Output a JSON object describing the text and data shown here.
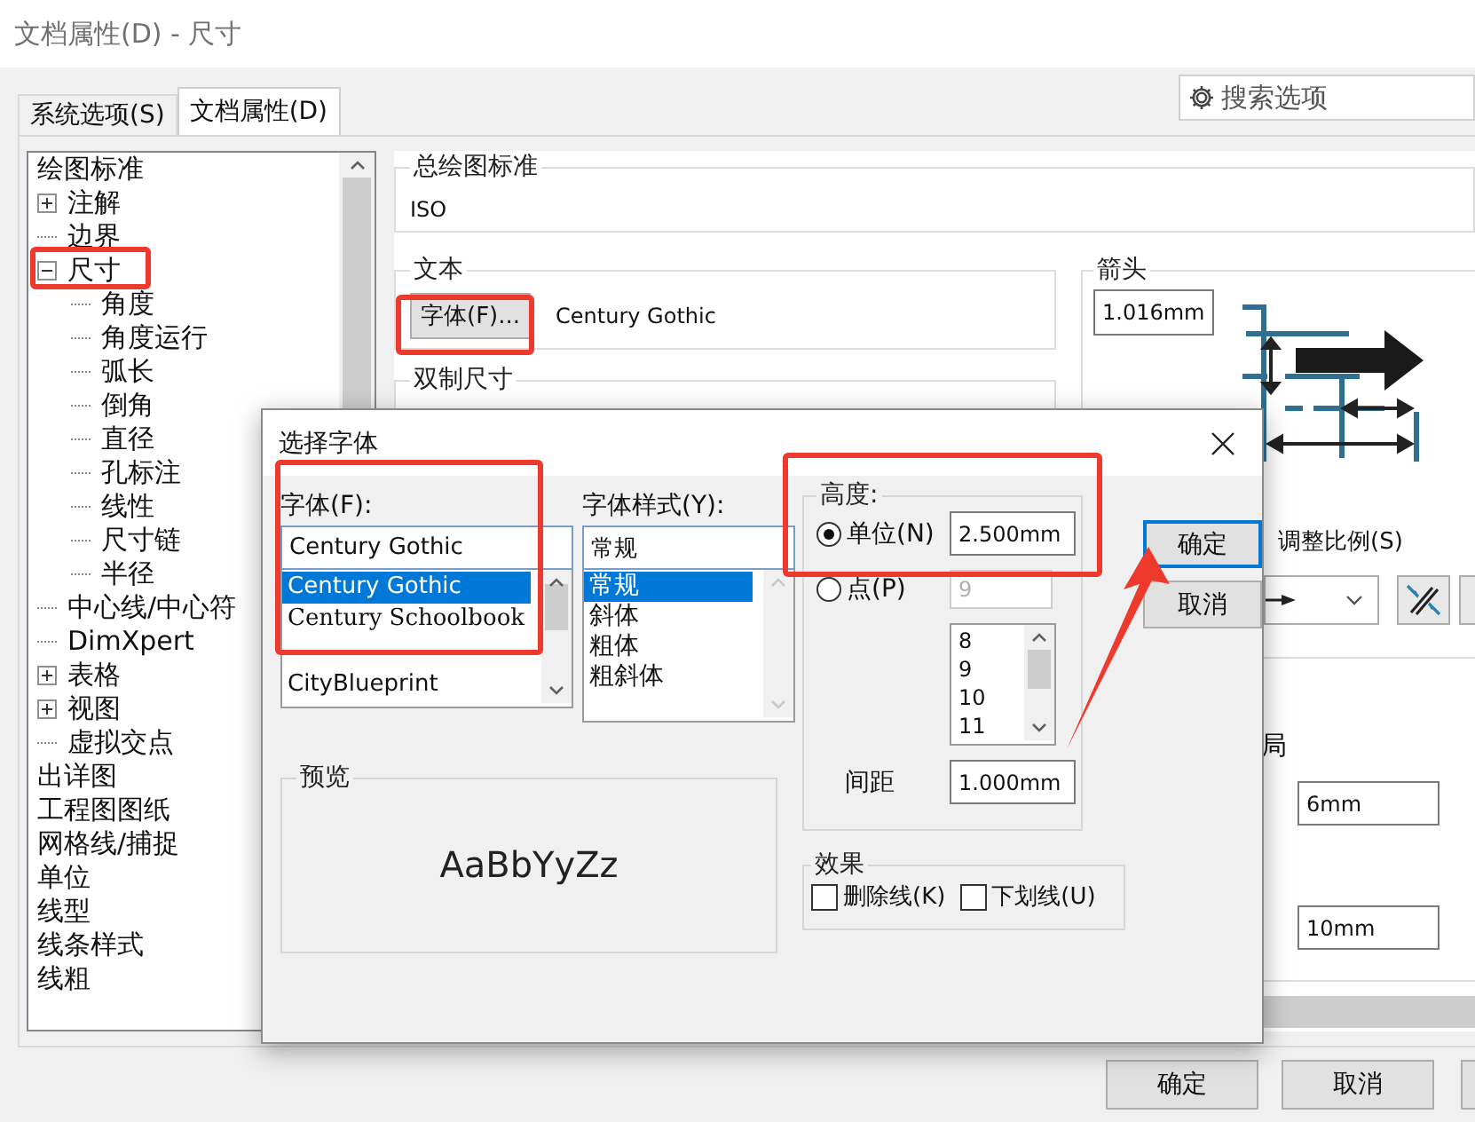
{
  "window": {
    "title": "文档属性(D) - 尺寸"
  },
  "tabs": [
    {
      "label": "系统选项(S)",
      "selected": false
    },
    {
      "label": "文档属性(D)",
      "selected": true
    }
  ],
  "search": {
    "placeholder": "搜索选项"
  },
  "tree": [
    {
      "label": "绘图标准",
      "children": [
        {
          "label": "注解",
          "expanded": false
        },
        {
          "label": "边界"
        },
        {
          "label": "尺寸",
          "expanded": true,
          "children": [
            {
              "label": "角度"
            },
            {
              "label": "角度运行"
            },
            {
              "label": "弧长"
            },
            {
              "label": "倒角"
            },
            {
              "label": "直径"
            },
            {
              "label": "孔标注"
            },
            {
              "label": "线性"
            },
            {
              "label": "尺寸链"
            },
            {
              "label": "半径"
            }
          ]
        },
        {
          "label": "中心线/中心符"
        },
        {
          "label": "DimXpert"
        },
        {
          "label": "表格",
          "expanded": false
        },
        {
          "label": "视图",
          "expanded": false
        },
        {
          "label": "虚拟交点"
        }
      ]
    },
    {
      "label": "出详图"
    },
    {
      "label": "工程图图纸"
    },
    {
      "label": "网格线/捕捉"
    },
    {
      "label": "单位"
    },
    {
      "label": "线型"
    },
    {
      "label": "线条样式"
    },
    {
      "label": "线粗"
    }
  ],
  "general_standard": {
    "title": "总绘图标准",
    "value": "ISO"
  },
  "text_group": {
    "title": "文本",
    "font_button": "字体(F)...",
    "font_name": "Century Gothic"
  },
  "dual_dimension": {
    "title": "双制尺寸"
  },
  "arrows": {
    "title": "箭头",
    "size": "1.016mm"
  },
  "scale_label": "调整比例(S)",
  "layout": {
    "title": "局",
    "fields": [
      "6mm",
      "10mm"
    ]
  },
  "buttons": [
    "确定",
    "取消"
  ],
  "font_dialog": {
    "title": "选择字体",
    "font": {
      "label": "字体(F):",
      "value": "Century Gothic",
      "options": [
        {
          "label": "Century Gothic",
          "kind": "sans",
          "selected": true
        },
        {
          "label": "Century Schoolbook",
          "kind": "serif",
          "selected": false
        },
        {
          "label": "CityBlueprint",
          "kind": "sans",
          "selected": false
        }
      ]
    },
    "style": {
      "label": "字体样式(Y):",
      "value": "常规",
      "options": [
        {
          "label": "常规",
          "selected": true
        },
        {
          "label": "斜体",
          "selected": false
        },
        {
          "label": "粗体",
          "selected": false
        },
        {
          "label": "粗斜体",
          "selected": false
        }
      ]
    },
    "height": {
      "title": "高度:",
      "radios": [
        {
          "label": "单位(N)",
          "selected": true,
          "value": "2.500mm"
        },
        {
          "label": "点(P)",
          "selected": false,
          "value": "9"
        }
      ],
      "sizes": [
        "8",
        "9",
        "10",
        "11"
      ],
      "spacing_label": "间距",
      "spacing": "1.000mm"
    },
    "effects": {
      "title": "效果",
      "items": [
        {
          "label": "删除线(K)",
          "checked": false
        },
        {
          "label": "下划线(U)",
          "checked": false
        }
      ]
    },
    "preview": {
      "title": "预览",
      "sample": "AaBbYyZz"
    },
    "buttons": [
      {
        "label": "确定",
        "default": true
      },
      {
        "label": "取消",
        "default": false
      }
    ]
  },
  "annotations": [
    {
      "kind": "frame"
    },
    {
      "kind": "frame"
    },
    {
      "kind": "frame"
    },
    {
      "kind": "frame"
    },
    {
      "kind": "arrow"
    }
  ]
}
